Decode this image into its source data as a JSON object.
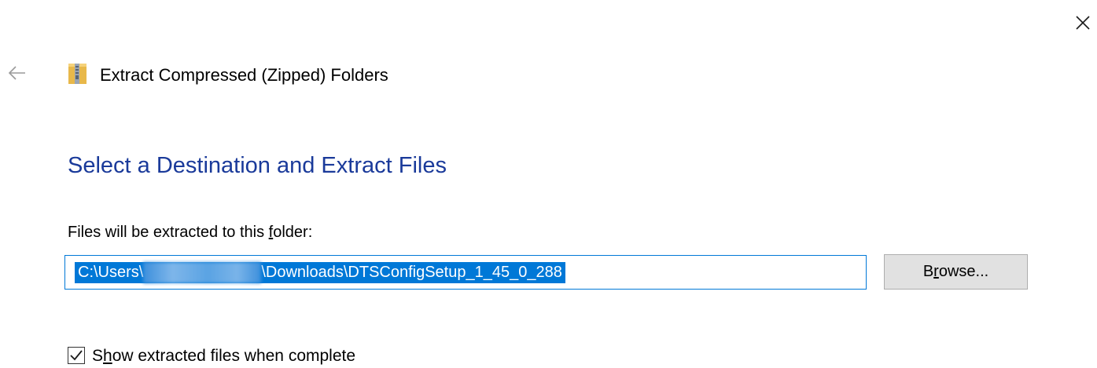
{
  "window": {
    "title": "Extract Compressed (Zipped) Folders",
    "close_icon": "close-icon",
    "back_icon": "back-arrow-icon",
    "app_icon": "zipped-folder-icon"
  },
  "page": {
    "heading": "Select a Destination and Extract Files",
    "heading_color": "#1a3a9a"
  },
  "destination": {
    "label_pre": "Files will be extracted to this ",
    "label_access": "f",
    "label_post": "older:",
    "path_prefix": "C:\\Users\\",
    "path_suffix": "\\Downloads\\DTSConfigSetup_1_45_0_288",
    "selection_color": "#0078d7"
  },
  "browse": {
    "label_pre": "B",
    "label_access": "r",
    "label_post": "owse..."
  },
  "show_files": {
    "checked": true,
    "label_pre": "S",
    "label_access": "h",
    "label_post": "ow extracted files when complete"
  }
}
